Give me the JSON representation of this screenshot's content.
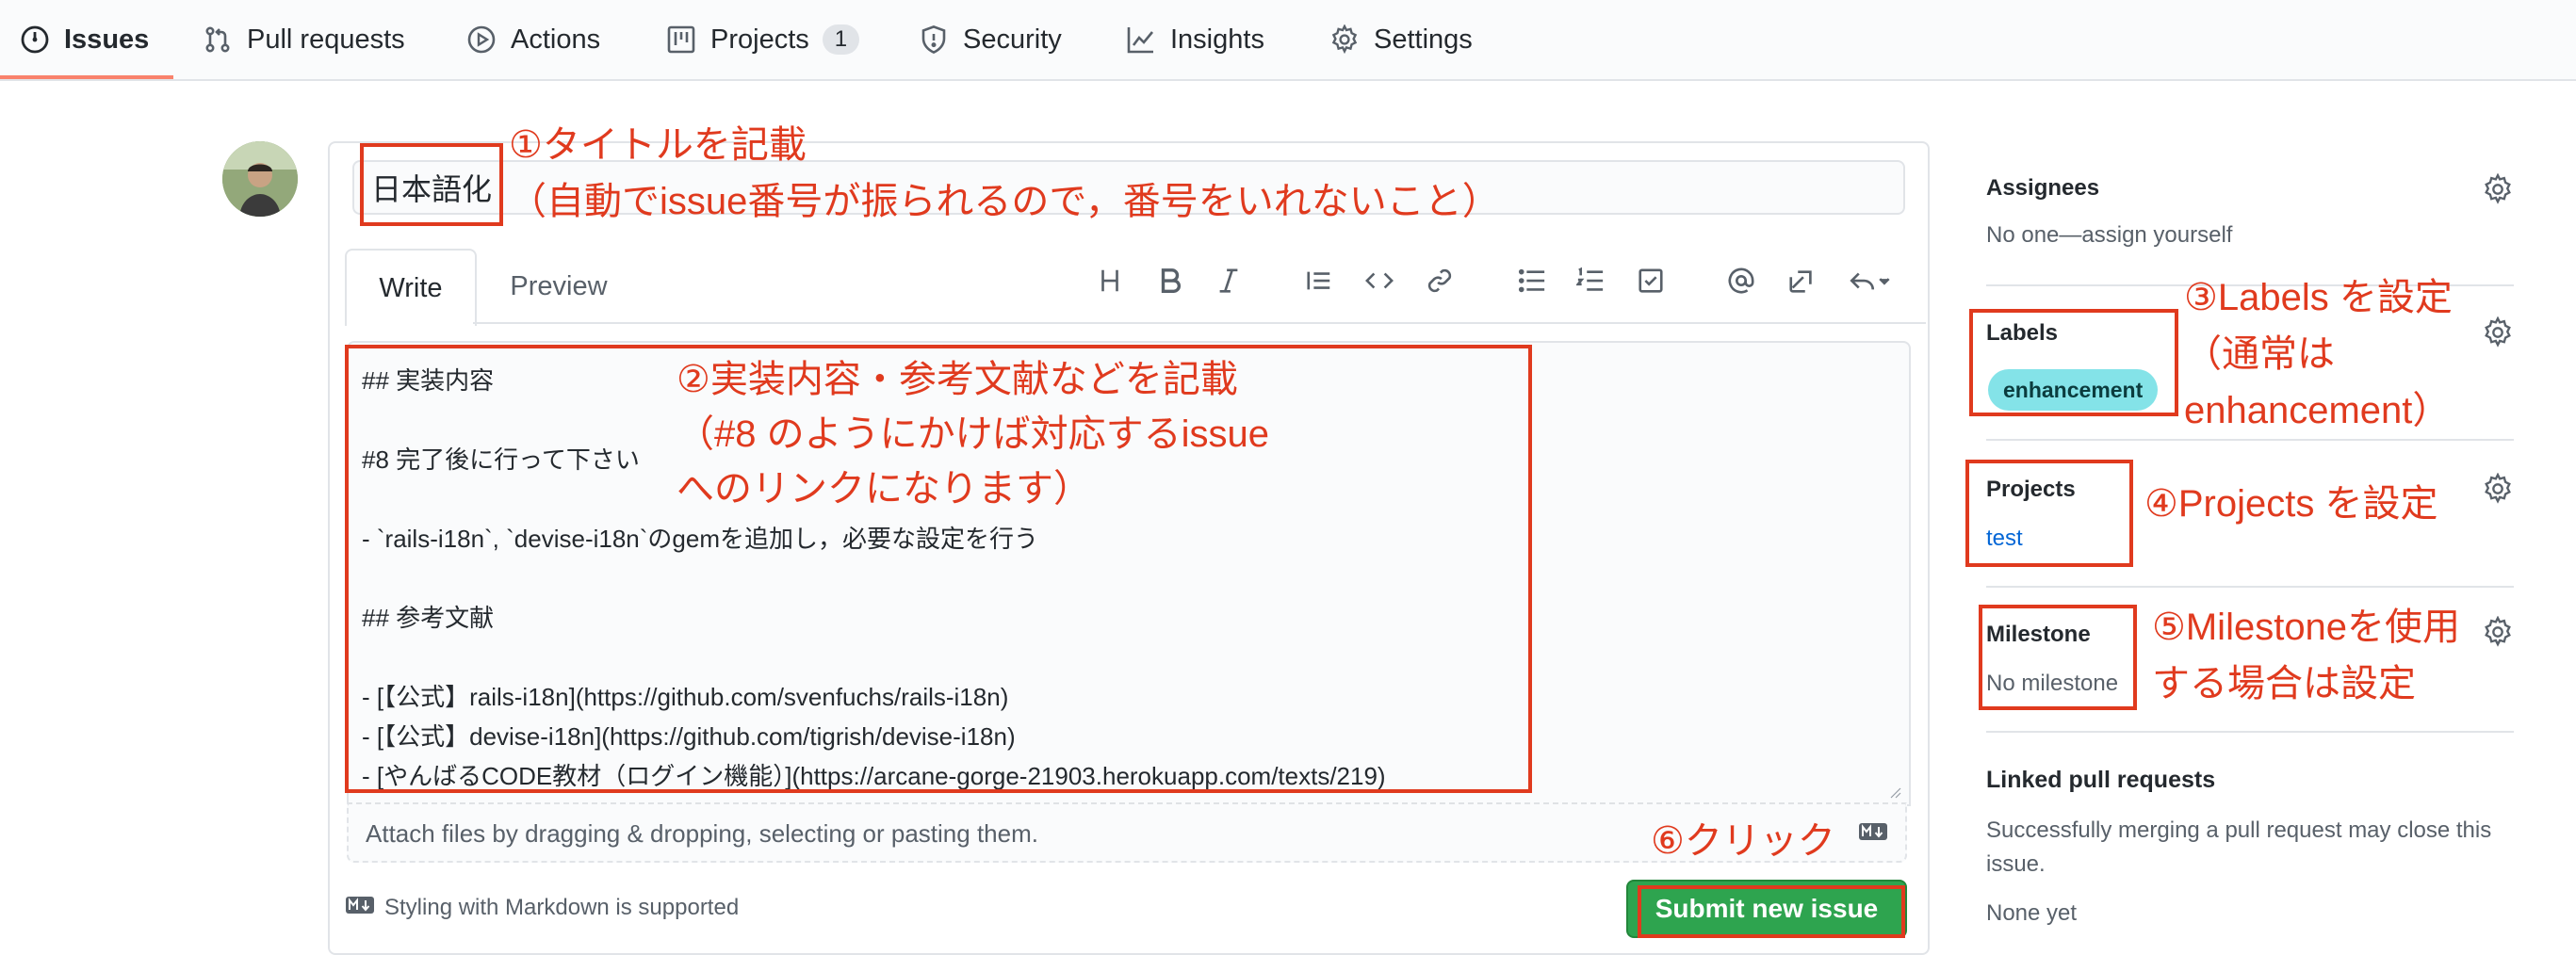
{
  "nav": {
    "tabs": [
      {
        "label": "Issues",
        "icon": "issue-opened-icon"
      },
      {
        "label": "Pull requests",
        "icon": "git-pull-request-icon"
      },
      {
        "label": "Actions",
        "icon": "play-icon"
      },
      {
        "label": "Projects",
        "icon": "project-icon",
        "count": "1"
      },
      {
        "label": "Security",
        "icon": "shield-icon"
      },
      {
        "label": "Insights",
        "icon": "graph-icon"
      },
      {
        "label": "Settings",
        "icon": "gear-icon"
      }
    ],
    "active_tab": "Issues"
  },
  "form": {
    "title_value": "日本語化",
    "write_tab": "Write",
    "preview_tab": "Preview",
    "body_lines": [
      "## 実装内容",
      "#8 完了後に行って下さい",
      "- `rails-i18n`, `devise-i18n`のgemを追加し，必要な設定を行う",
      "## 参考文献",
      "- [【公式】rails-i18n](https://github.com/svenfuchs/rails-i18n)",
      "- [【公式】devise-i18n](https://github.com/tigrish/devise-i18n)",
      "- [やんばるCODE教材（ログイン機能）](https://arcane-gorge-21903.herokuapp.com/texts/219)"
    ],
    "attach_text": "Attach files by dragging & dropping, selecting or pasting them.",
    "markdown_note": "Styling with Markdown is supported",
    "submit_label": "Submit new issue"
  },
  "sidebar": {
    "assignees": {
      "heading": "Assignees",
      "value": "No one—assign yourself"
    },
    "labels": {
      "heading": "Labels",
      "value": "enhancement"
    },
    "projects": {
      "heading": "Projects",
      "value": "test"
    },
    "milestone": {
      "heading": "Milestone",
      "value": "No milestone"
    },
    "linked_prs": {
      "heading": "Linked pull requests",
      "description": "Successfully merging a pull request may close this issue.",
      "value": "None yet"
    }
  },
  "annotations": {
    "a1": "①タイトルを記載\n（自動でissue番号が振られるので，番号をいれないこと）",
    "a2": "②実装内容・参考文献などを記載\n（#8 のようにかけば対応するissue\nへのリンクになります）",
    "a3": "③Labels を設定\n（通常は\nenhancement）",
    "a4": "④Projects を設定",
    "a5": "⑤Milestoneを使用\nする場合は設定",
    "a6": "⑥クリック"
  },
  "colors": {
    "accent": "#e03a1e",
    "submit": "#2ea44f",
    "label": "#84e3e8",
    "tab_underline": "#f9826c",
    "link": "#0366d6"
  }
}
